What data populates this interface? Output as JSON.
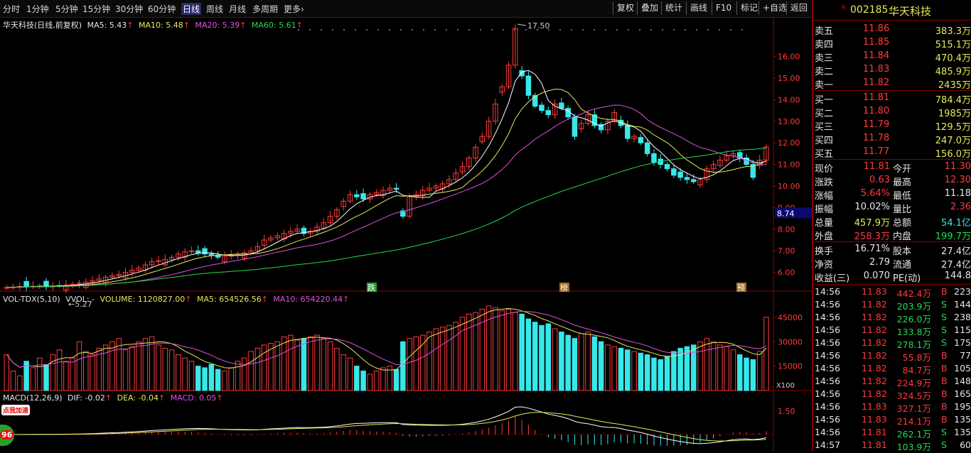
{
  "toolbar": {
    "periods": [
      "分时",
      "1分钟",
      "5分钟",
      "15分钟",
      "30分钟",
      "60分钟",
      "日线",
      "周线",
      "月线",
      "多周期",
      "更多›"
    ],
    "active_period": "日线",
    "right_buttons": [
      "复权",
      "叠加",
      "统计",
      "画线",
      "F10",
      "标记",
      "+自选",
      "返回"
    ]
  },
  "main_legend": {
    "title": "华天科技(日线,前复权)",
    "ma5": "MA5: 5.43",
    "ma10": "MA10: 5.48",
    "ma20": "MA20: 5.39",
    "ma60": "MA60: 5.61"
  },
  "vol_legend": {
    "name": "VOL-TDX(5,10)",
    "vvol": "VVOL: -",
    "volume": "VOLUME: 1120827.00",
    "ma5": "MA5: 654526.56",
    "ma10": "MA10: 654220.44"
  },
  "macd_legend": {
    "name": "MACD(12,26,9)",
    "dif": "DIF: -0.02",
    "dea": "DEA: -0.04",
    "macd": "MACD: 0.05"
  },
  "annotations": {
    "high": "17.50",
    "low": "5.27",
    "price_marker": "8.74",
    "vol_unit": "X100",
    "promo": "点我加速",
    "promo_num": "96",
    "markers": [
      "跌",
      "榜",
      "预"
    ]
  },
  "chart_data": {
    "type": "candlestick",
    "price_axis": {
      "ticks": [
        "16.00",
        "15.00",
        "14.00",
        "13.00",
        "12.00",
        "11.00",
        "10.00",
        "9.00",
        "8.00",
        "7.00",
        "6.00"
      ],
      "range": [
        5.0,
        17.5
      ]
    },
    "volume_axis": {
      "ticks": [
        "45000",
        "30000",
        "15000"
      ]
    },
    "macd_axis": {
      "ticks": [
        "1.50"
      ]
    },
    "colors": {
      "up": "#ff3b3b",
      "down": "#36e8ea",
      "ma5": "#ffffff",
      "ma10": "#e8e85a",
      "ma20": "#e050e0",
      "ma60": "#29d94d"
    },
    "close_series": [
      5.3,
      5.32,
      5.35,
      5.33,
      5.36,
      5.38,
      5.34,
      5.37,
      5.4,
      5.42,
      5.45,
      5.5,
      5.55,
      5.62,
      5.7,
      5.78,
      5.85,
      5.9,
      6.0,
      6.1,
      6.2,
      6.35,
      6.5,
      6.55,
      6.6,
      6.7,
      6.85,
      6.95,
      7.0,
      6.9,
      6.85,
      6.8,
      6.7,
      6.75,
      6.8,
      6.85,
      6.9,
      7.0,
      7.2,
      7.5,
      7.6,
      7.7,
      7.8,
      7.9,
      8.0,
      7.8,
      7.9,
      8.1,
      8.3,
      8.6,
      8.9,
      9.3,
      9.6,
      9.5,
      9.4,
      9.6,
      9.7,
      9.8,
      9.9,
      9.85,
      8.6,
      9.5,
      9.6,
      9.8,
      9.9,
      10.0,
      10.1,
      10.3,
      10.6,
      10.9,
      11.3,
      11.8,
      12.3,
      13.0,
      13.8,
      14.6,
      15.6,
      17.3,
      15.1,
      14.2,
      13.7,
      13.5,
      13.3,
      13.8,
      13.6,
      13.2,
      12.3,
      12.9,
      13.3,
      12.8,
      12.6,
      13.0,
      13.4,
      12.8,
      12.2,
      12.3,
      12.0,
      11.5,
      11.1,
      11.0,
      10.8,
      10.5,
      10.4,
      10.3,
      10.2,
      10.3,
      10.8,
      11.0,
      11.2,
      11.4,
      11.5,
      11.3,
      11.0,
      10.4,
      11.2,
      11.81
    ],
    "volume_series": [
      22000,
      12000,
      9000,
      18000,
      14000,
      20000,
      16000,
      22000,
      25000,
      18000,
      20000,
      30000,
      24000,
      22000,
      26000,
      28000,
      30000,
      32000,
      25000,
      27000,
      30000,
      32000,
      33000,
      28000,
      26000,
      25000,
      22000,
      20000,
      18000,
      15000,
      14000,
      16000,
      13000,
      12000,
      14000,
      18000,
      20000,
      24000,
      26000,
      28000,
      29000,
      30000,
      33000,
      34000,
      31000,
      32000,
      33000,
      34000,
      32000,
      30000,
      26000,
      22000,
      20000,
      15000,
      12000,
      10000,
      12000,
      14000,
      15000,
      13000,
      30000,
      32000,
      33000,
      34000,
      36000,
      38000,
      39000,
      40000,
      42000,
      45000,
      47000,
      48000,
      50000,
      52000,
      51000,
      49000,
      50000,
      48000,
      47000,
      44000,
      42000,
      40000,
      41000,
      38000,
      36000,
      34000,
      32000,
      35000,
      36000,
      33000,
      30000,
      28000,
      27000,
      26000,
      25000,
      24000,
      23000,
      22000,
      20000,
      19000,
      21000,
      24000,
      26000,
      27000,
      28000,
      30000,
      32000,
      30000,
      28000,
      27000,
      25000,
      22000,
      20000,
      19000,
      24000,
      45000
    ],
    "macd_axis_zero": 0
  },
  "panel": {
    "code": "002185",
    "name": "华天科技",
    "asks": [
      {
        "label": "卖五",
        "price": "11.86",
        "vol": "383.3万"
      },
      {
        "label": "卖四",
        "price": "11.85",
        "vol": "515.1万"
      },
      {
        "label": "卖三",
        "price": "11.84",
        "vol": "470.4万"
      },
      {
        "label": "卖二",
        "price": "11.83",
        "vol": "485.9万"
      },
      {
        "label": "卖一",
        "price": "11.82",
        "vol": "2435万"
      }
    ],
    "bids": [
      {
        "label": "买一",
        "price": "11.81",
        "vol": "784.4万"
      },
      {
        "label": "买二",
        "price": "11.80",
        "vol": "1985万"
      },
      {
        "label": "买三",
        "price": "11.79",
        "vol": "129.5万"
      },
      {
        "label": "买四",
        "price": "11.78",
        "vol": "247.0万"
      },
      {
        "label": "买五",
        "price": "11.77",
        "vol": "156.0万"
      }
    ],
    "stats": [
      {
        "l1": "现价",
        "v1": "11.81",
        "c1": "red",
        "l2": "今开",
        "v2": "11.30",
        "c2": "red"
      },
      {
        "l1": "涨跌",
        "v1": "0.63",
        "c1": "red",
        "l2": "最高",
        "v2": "12.30",
        "c2": "red"
      },
      {
        "l1": "涨幅",
        "v1": "5.64%",
        "c1": "red",
        "l2": "最低",
        "v2": "11.18",
        "c2": "white"
      },
      {
        "l1": "振幅",
        "v1": "10.02%",
        "c1": "white",
        "l2": "量比",
        "v2": "2.36",
        "c2": "red"
      },
      {
        "l1": "总量",
        "v1": "457.9万",
        "c1": "yellow",
        "l2": "总额",
        "v2": "54.1亿",
        "c2": "cyan"
      },
      {
        "l1": "外盘",
        "v1": "258.3万",
        "c1": "red",
        "l2": "内盘",
        "v2": "199.7万",
        "c2": "green"
      }
    ],
    "stats2": [
      {
        "l1": "换手",
        "v1": "16.71%",
        "l2": "股本",
        "v2": "27.4亿"
      },
      {
        "l1": "净资",
        "v1": "2.79",
        "l2": "流通",
        "v2": "27.4亿"
      },
      {
        "l1": "收益(三)",
        "v1": "0.070",
        "l2": "PE(动)",
        "v2": "144.8"
      }
    ],
    "ticks": [
      {
        "t": "14:56",
        "p": "11.83",
        "v": "442.4万",
        "bs": "B",
        "n": "223"
      },
      {
        "t": "14:56",
        "p": "11.82",
        "v": "203.9万",
        "bs": "S",
        "n": "144"
      },
      {
        "t": "14:56",
        "p": "11.82",
        "v": "226.0万",
        "bs": "S",
        "n": "238"
      },
      {
        "t": "14:56",
        "p": "11.82",
        "v": "133.8万",
        "bs": "S",
        "n": "115"
      },
      {
        "t": "14:56",
        "p": "11.82",
        "v": "278.1万",
        "bs": "S",
        "n": "175"
      },
      {
        "t": "14:56",
        "p": "11.82",
        "v": "55.8万",
        "bs": "B",
        "n": "77"
      },
      {
        "t": "14:56",
        "p": "11.82",
        "v": "84.7万",
        "bs": "B",
        "n": "105"
      },
      {
        "t": "14:56",
        "p": "11.82",
        "v": "224.9万",
        "bs": "B",
        "n": "148"
      },
      {
        "t": "14:56",
        "p": "11.82",
        "v": "324.5万",
        "bs": "B",
        "n": "165"
      },
      {
        "t": "14:56",
        "p": "11.83",
        "v": "327.1万",
        "bs": "B",
        "n": "195"
      },
      {
        "t": "14:56",
        "p": "11.83",
        "v": "214.1万",
        "bs": "B",
        "n": "135"
      },
      {
        "t": "14:56",
        "p": "11.81",
        "v": "262.1万",
        "bs": "S",
        "n": "135"
      },
      {
        "t": "14:57",
        "p": "11.81",
        "v": "103.9万",
        "bs": "S",
        "n": "60"
      }
    ]
  }
}
